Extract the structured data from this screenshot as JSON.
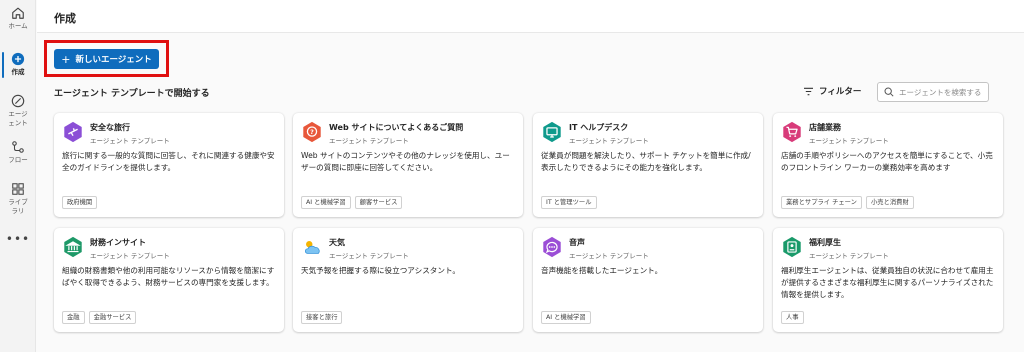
{
  "rail": {
    "home": "ホーム",
    "create": "作成",
    "agents": "エージ\nェント",
    "flows": "フロー",
    "library": "ライブ\nラリ",
    "more": "•••"
  },
  "header": {
    "title": "作成"
  },
  "new_agent_label": "新しいエージェント",
  "section_title": "エージェント テンプレートで開始する",
  "filter_label": "フィルター",
  "search_placeholder": "エージェントを検索する",
  "colors": {
    "accent": "#0f6cbd",
    "highlight": "#e01010"
  },
  "cards": [
    {
      "title": "安全な旅行",
      "subtitle": "エージェント テンプレート",
      "description": "旅行に関する一般的な質問に回答し、それに関連する健康や安全のガイドラインを提供します。",
      "tags": [
        "政府機関"
      ],
      "icon": "airplane-icon",
      "color": "#8b4fd6"
    },
    {
      "title": "Web サイトについてよくあるご質問",
      "subtitle": "エージェント テンプレート",
      "description": "Web サイトのコンテンツやその他のナレッジを使用し、ユーザーの質問に即座に回答してください。",
      "tags": [
        "AI と機械学習",
        "顧客サービス"
      ],
      "icon": "question-chat-icon",
      "color": "#e8573a"
    },
    {
      "title": "IT ヘルプデスク",
      "subtitle": "エージェント テンプレート",
      "description": "従業員が問題を解決したり、サポート チケットを簡単に作成/表示したりできるようにその能力を強化します。",
      "tags": [
        "IT と管理ツール"
      ],
      "icon": "monitor-icon",
      "color": "#0f9a8c"
    },
    {
      "title": "店舗業務",
      "subtitle": "エージェント テンプレート",
      "description": "店舗の手順やポリシーへのアクセスを簡単にすることで、小売のフロントライン ワーカーの業務効率を高めます",
      "tags": [
        "業務とサプライ チェーン",
        "小売と消費財"
      ],
      "icon": "shopping-cart-icon",
      "color": "#d83b7a"
    },
    {
      "title": "財務インサイト",
      "subtitle": "エージェント テンプレート",
      "description": "組織の財務書類や他の利用可能なリソースから情報を簡潔にすばやく取得できるよう、財務サービスの専門家を支援します。",
      "tags": [
        "金融",
        "金融サービス"
      ],
      "icon": "bank-icon",
      "color": "#1e9968"
    },
    {
      "title": "天気",
      "subtitle": "エージェント テンプレート",
      "description": "天気予報を把握する際に役立つアシスタント。",
      "tags": [
        "接客と旅行"
      ],
      "icon": "weather-icon",
      "color": "#2e8fd8"
    },
    {
      "title": "音声",
      "subtitle": "エージェント テンプレート",
      "description": "音声機能を搭載したエージェント。",
      "tags": [
        "AI と機械学習"
      ],
      "icon": "voice-chat-icon",
      "color": "#9b4ed6"
    },
    {
      "title": "福利厚生",
      "subtitle": "エージェント テンプレート",
      "description": "福利厚生エージェントは、従業員独自の状況に合わせて雇用主が提供するさまざまな福利厚生に関するパーソナライズされた情報を提供します。",
      "tags": [
        "人事"
      ],
      "icon": "id-badge-icon",
      "color": "#1a9a6a"
    }
  ]
}
